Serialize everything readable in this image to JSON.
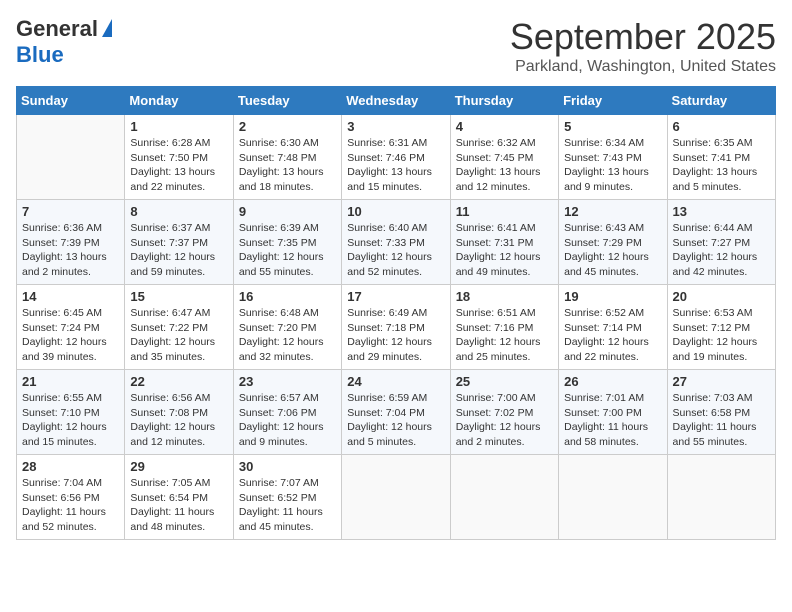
{
  "header": {
    "logo": {
      "general": "General",
      "blue": "Blue"
    },
    "title": "September 2025",
    "location": "Parkland, Washington, United States"
  },
  "days_of_week": [
    "Sunday",
    "Monday",
    "Tuesday",
    "Wednesday",
    "Thursday",
    "Friday",
    "Saturday"
  ],
  "weeks": [
    [
      {
        "day": null
      },
      {
        "day": "1",
        "sunrise": "Sunrise: 6:28 AM",
        "sunset": "Sunset: 7:50 PM",
        "daylight": "Daylight: 13 hours and 22 minutes."
      },
      {
        "day": "2",
        "sunrise": "Sunrise: 6:30 AM",
        "sunset": "Sunset: 7:48 PM",
        "daylight": "Daylight: 13 hours and 18 minutes."
      },
      {
        "day": "3",
        "sunrise": "Sunrise: 6:31 AM",
        "sunset": "Sunset: 7:46 PM",
        "daylight": "Daylight: 13 hours and 15 minutes."
      },
      {
        "day": "4",
        "sunrise": "Sunrise: 6:32 AM",
        "sunset": "Sunset: 7:45 PM",
        "daylight": "Daylight: 13 hours and 12 minutes."
      },
      {
        "day": "5",
        "sunrise": "Sunrise: 6:34 AM",
        "sunset": "Sunset: 7:43 PM",
        "daylight": "Daylight: 13 hours and 9 minutes."
      },
      {
        "day": "6",
        "sunrise": "Sunrise: 6:35 AM",
        "sunset": "Sunset: 7:41 PM",
        "daylight": "Daylight: 13 hours and 5 minutes."
      }
    ],
    [
      {
        "day": "7",
        "sunrise": "Sunrise: 6:36 AM",
        "sunset": "Sunset: 7:39 PM",
        "daylight": "Daylight: 13 hours and 2 minutes."
      },
      {
        "day": "8",
        "sunrise": "Sunrise: 6:37 AM",
        "sunset": "Sunset: 7:37 PM",
        "daylight": "Daylight: 12 hours and 59 minutes."
      },
      {
        "day": "9",
        "sunrise": "Sunrise: 6:39 AM",
        "sunset": "Sunset: 7:35 PM",
        "daylight": "Daylight: 12 hours and 55 minutes."
      },
      {
        "day": "10",
        "sunrise": "Sunrise: 6:40 AM",
        "sunset": "Sunset: 7:33 PM",
        "daylight": "Daylight: 12 hours and 52 minutes."
      },
      {
        "day": "11",
        "sunrise": "Sunrise: 6:41 AM",
        "sunset": "Sunset: 7:31 PM",
        "daylight": "Daylight: 12 hours and 49 minutes."
      },
      {
        "day": "12",
        "sunrise": "Sunrise: 6:43 AM",
        "sunset": "Sunset: 7:29 PM",
        "daylight": "Daylight: 12 hours and 45 minutes."
      },
      {
        "day": "13",
        "sunrise": "Sunrise: 6:44 AM",
        "sunset": "Sunset: 7:27 PM",
        "daylight": "Daylight: 12 hours and 42 minutes."
      }
    ],
    [
      {
        "day": "14",
        "sunrise": "Sunrise: 6:45 AM",
        "sunset": "Sunset: 7:24 PM",
        "daylight": "Daylight: 12 hours and 39 minutes."
      },
      {
        "day": "15",
        "sunrise": "Sunrise: 6:47 AM",
        "sunset": "Sunset: 7:22 PM",
        "daylight": "Daylight: 12 hours and 35 minutes."
      },
      {
        "day": "16",
        "sunrise": "Sunrise: 6:48 AM",
        "sunset": "Sunset: 7:20 PM",
        "daylight": "Daylight: 12 hours and 32 minutes."
      },
      {
        "day": "17",
        "sunrise": "Sunrise: 6:49 AM",
        "sunset": "Sunset: 7:18 PM",
        "daylight": "Daylight: 12 hours and 29 minutes."
      },
      {
        "day": "18",
        "sunrise": "Sunrise: 6:51 AM",
        "sunset": "Sunset: 7:16 PM",
        "daylight": "Daylight: 12 hours and 25 minutes."
      },
      {
        "day": "19",
        "sunrise": "Sunrise: 6:52 AM",
        "sunset": "Sunset: 7:14 PM",
        "daylight": "Daylight: 12 hours and 22 minutes."
      },
      {
        "day": "20",
        "sunrise": "Sunrise: 6:53 AM",
        "sunset": "Sunset: 7:12 PM",
        "daylight": "Daylight: 12 hours and 19 minutes."
      }
    ],
    [
      {
        "day": "21",
        "sunrise": "Sunrise: 6:55 AM",
        "sunset": "Sunset: 7:10 PM",
        "daylight": "Daylight: 12 hours and 15 minutes."
      },
      {
        "day": "22",
        "sunrise": "Sunrise: 6:56 AM",
        "sunset": "Sunset: 7:08 PM",
        "daylight": "Daylight: 12 hours and 12 minutes."
      },
      {
        "day": "23",
        "sunrise": "Sunrise: 6:57 AM",
        "sunset": "Sunset: 7:06 PM",
        "daylight": "Daylight: 12 hours and 9 minutes."
      },
      {
        "day": "24",
        "sunrise": "Sunrise: 6:59 AM",
        "sunset": "Sunset: 7:04 PM",
        "daylight": "Daylight: 12 hours and 5 minutes."
      },
      {
        "day": "25",
        "sunrise": "Sunrise: 7:00 AM",
        "sunset": "Sunset: 7:02 PM",
        "daylight": "Daylight: 12 hours and 2 minutes."
      },
      {
        "day": "26",
        "sunrise": "Sunrise: 7:01 AM",
        "sunset": "Sunset: 7:00 PM",
        "daylight": "Daylight: 11 hours and 58 minutes."
      },
      {
        "day": "27",
        "sunrise": "Sunrise: 7:03 AM",
        "sunset": "Sunset: 6:58 PM",
        "daylight": "Daylight: 11 hours and 55 minutes."
      }
    ],
    [
      {
        "day": "28",
        "sunrise": "Sunrise: 7:04 AM",
        "sunset": "Sunset: 6:56 PM",
        "daylight": "Daylight: 11 hours and 52 minutes."
      },
      {
        "day": "29",
        "sunrise": "Sunrise: 7:05 AM",
        "sunset": "Sunset: 6:54 PM",
        "daylight": "Daylight: 11 hours and 48 minutes."
      },
      {
        "day": "30",
        "sunrise": "Sunrise: 7:07 AM",
        "sunset": "Sunset: 6:52 PM",
        "daylight": "Daylight: 11 hours and 45 minutes."
      },
      {
        "day": null
      },
      {
        "day": null
      },
      {
        "day": null
      },
      {
        "day": null
      }
    ]
  ]
}
